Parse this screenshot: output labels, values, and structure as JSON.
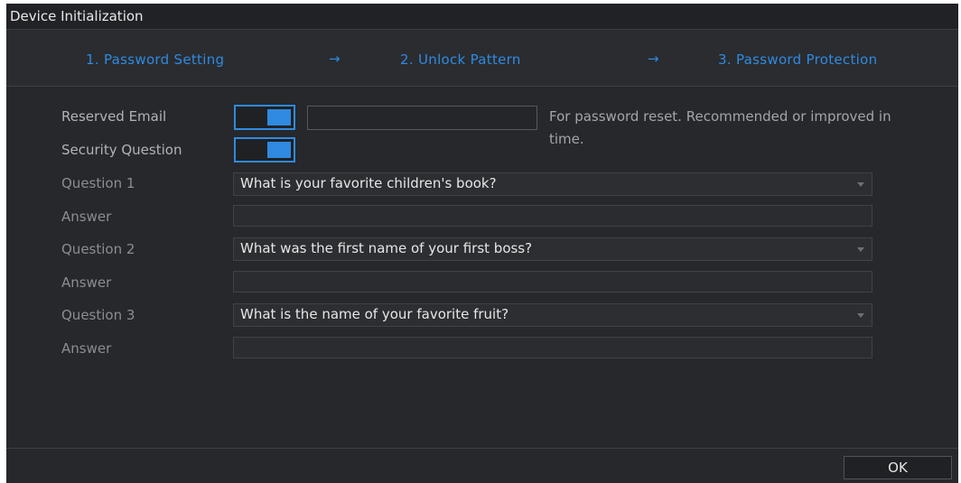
{
  "window": {
    "title": "Device Initialization"
  },
  "steps": [
    {
      "label": "1.  Password Setting"
    },
    {
      "label": "2.  Unlock Pattern"
    },
    {
      "label": "3.  Password Protection"
    }
  ],
  "step_arrow": "→",
  "form": {
    "reserved_email": {
      "label": "Reserved Email",
      "enabled": true,
      "value": ""
    },
    "security_question": {
      "label": "Security Question",
      "enabled": true
    },
    "hint": "For password reset. Recommended or improved in time.",
    "questions": [
      {
        "label": "Question 1",
        "selected": "What is your favorite children's book?",
        "answer_label": "Answer",
        "answer": ""
      },
      {
        "label": "Question 2",
        "selected": "What was the first name of your first boss?",
        "answer_label": "Answer",
        "answer": ""
      },
      {
        "label": "Question 3",
        "selected": "What is the name of your favorite fruit?",
        "answer_label": "Answer",
        "answer": ""
      }
    ]
  },
  "footer": {
    "ok_label": "OK"
  },
  "colors": {
    "accent": "#2f8ae0",
    "background": "#26282c",
    "label": "#8a8d92"
  },
  "icons": [
    "right-arrow-icon",
    "dropdown-caret-icon"
  ]
}
